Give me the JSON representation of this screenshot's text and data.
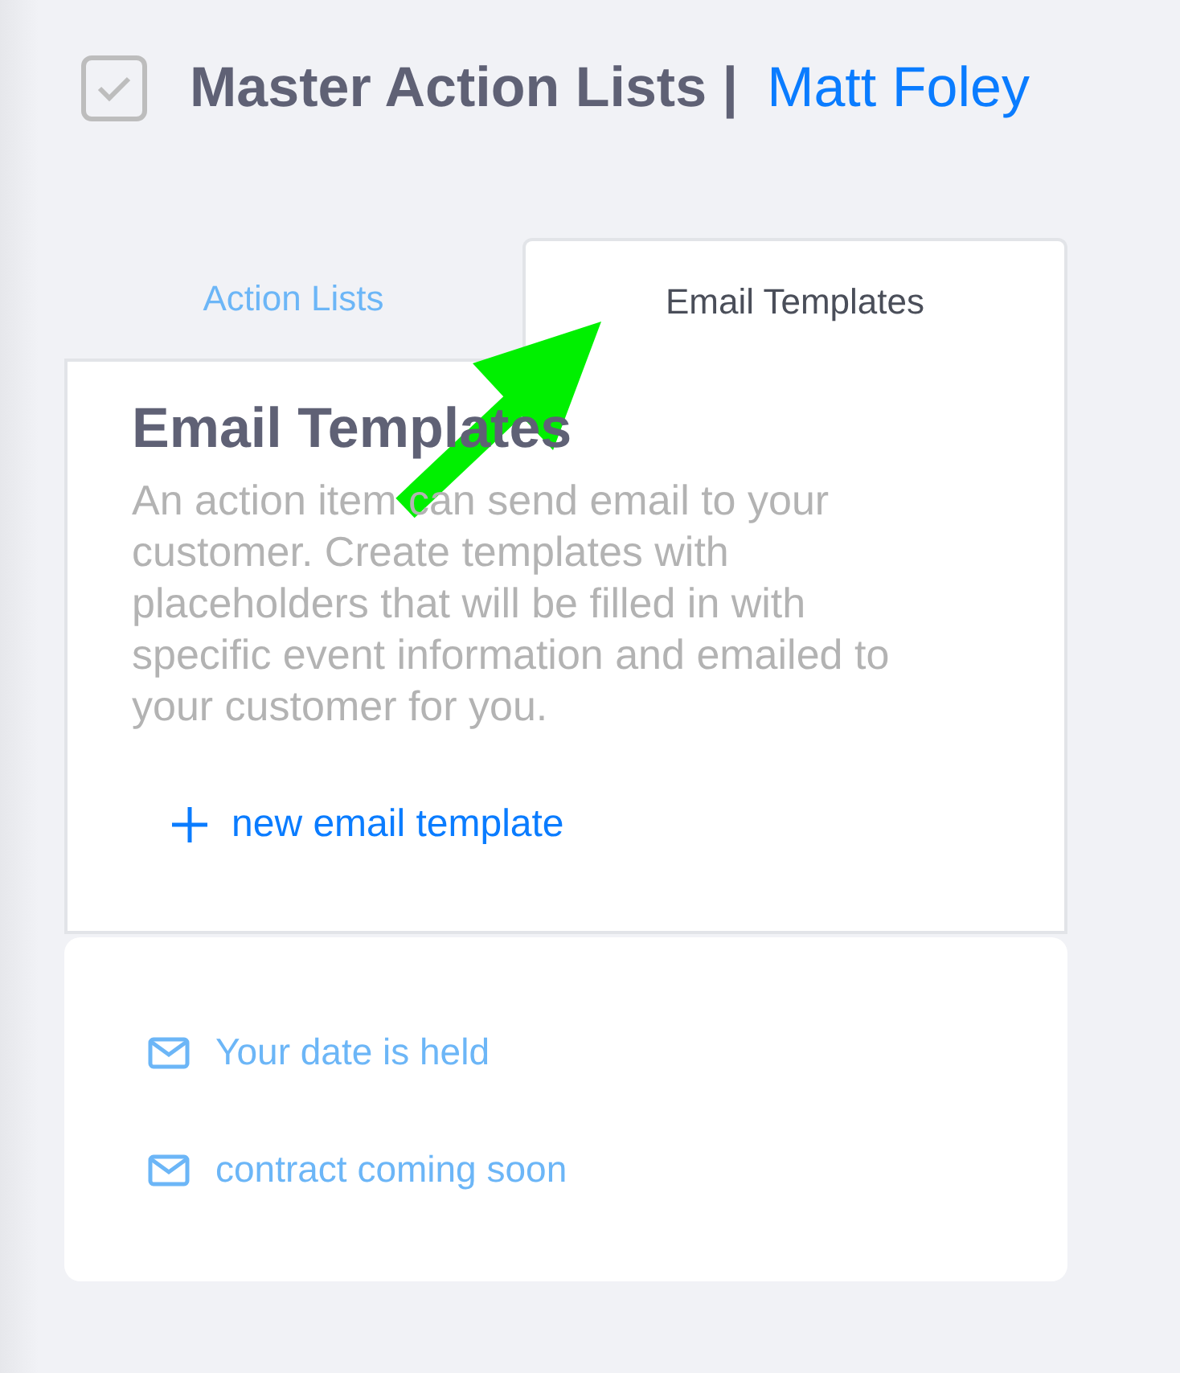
{
  "header": {
    "checked": true,
    "title": "Master Action Lists |",
    "user": "Matt Foley"
  },
  "tabs": [
    {
      "label": "Action Lists",
      "selected": false
    },
    {
      "label": "Email Templates",
      "selected": true
    }
  ],
  "panel": {
    "heading": "Email Templates",
    "description": "An action item can send email to your customer. Create templates with placeholders that will be filled in with specific event information and emailed to your customer for you.",
    "new_button": "new email template"
  },
  "templates": [
    {
      "name": "Your date is held"
    },
    {
      "name": "contract coming soon"
    }
  ]
}
